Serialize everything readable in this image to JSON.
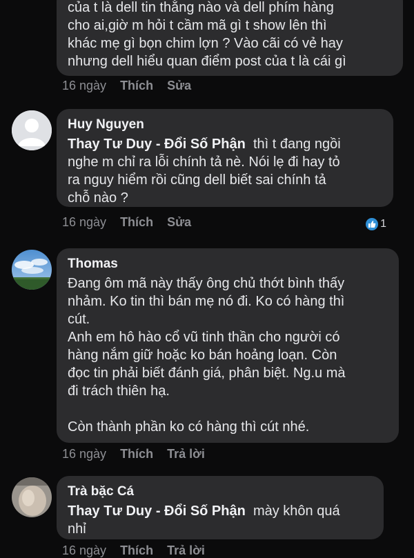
{
  "comments": [
    {
      "author": "",
      "text": "của t là dell tin thằng nào và dell phím hàng\ncho ai,giờ m hỏi t cầm mã gì t show lên thì\nkhác mẹ gì bọn chim lợn ? Vào cãi có vẻ hay\nnhưng dell hiểu quan điểm post của t là cái gì",
      "time": "16 ngày",
      "actions": [
        "Thích",
        "Sửa"
      ]
    },
    {
      "author": "Huy Nguyen",
      "mention": "Thay Tư Duy - Đổi Số Phận",
      "text_after_mention": "  thì t đang ngồi\nnghe m chỉ ra lỗi chính tả nè. Nói lẹ đi hay tỏ\nra nguy hiểm rồi cũng dell biết sai chính tả\nchỗ nào ?",
      "time": "16 ngày",
      "actions": [
        "Thích",
        "Sửa"
      ],
      "reaction_count": "1"
    },
    {
      "author": "Thomas",
      "text": "Đang ôm mã này thấy ông chủ thớt bình thấy\nnhảm. Ko tin thì bán mẹ nó đi. Ko có hàng thì\ncút.\nAnh em hô hào cổ vũ tinh thần cho người có\nhàng nắm giữ hoặc ko bán hoảng loạn. Còn\nđọc tin phải biết đánh giá, phân biệt. Ng.u mà\nđi trách thiên hạ.\n\nCòn thành phần ko có hàng thì cút nhé.",
      "time": "16 ngày",
      "actions": [
        "Thích",
        "Trả lời"
      ]
    },
    {
      "author": "Trà bặc Cá",
      "mention": "Thay Tư Duy - Đổi Số Phận",
      "text_after_mention": "  mày khôn quá\nnhỉ",
      "time": "16 ngày",
      "actions": [
        "Thích",
        "Trả lời"
      ]
    }
  ],
  "colors": {
    "background": "#0b0b0c",
    "bubble": "#2c2c2e",
    "meta_text": "#8d8e93",
    "like_blue": "#2f8fd6"
  }
}
